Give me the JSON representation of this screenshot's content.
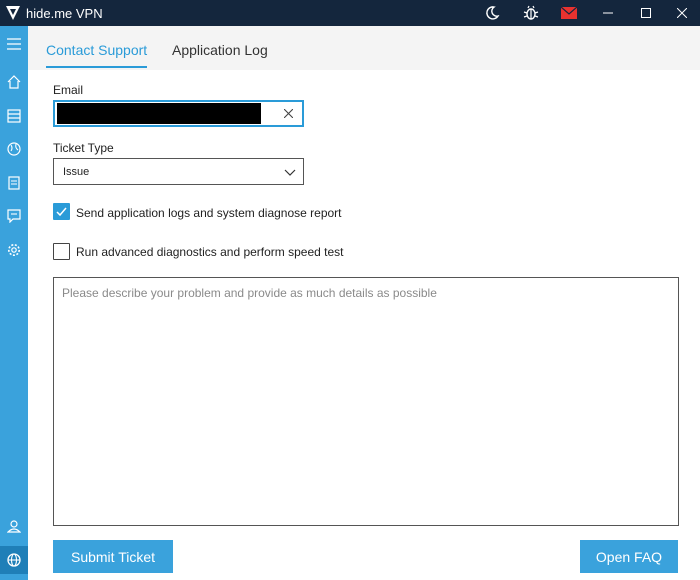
{
  "window": {
    "title": "hide.me VPN"
  },
  "titlebar": {
    "icons": [
      "moon-icon",
      "bug-icon",
      "mail-icon",
      "minimize-icon",
      "maximize-icon",
      "close-icon"
    ],
    "mail_color": "#e8322f"
  },
  "sidebar": {
    "items": [
      "menu-icon",
      "home-icon",
      "server-list-icon",
      "globe-icon",
      "document-icon",
      "support-chat-icon",
      "gear-icon"
    ],
    "bottom": [
      "user-icon",
      "language-globe-icon"
    ]
  },
  "tabs": [
    {
      "label": "Contact Support",
      "active": true
    },
    {
      "label": "Application Log",
      "active": false
    }
  ],
  "form": {
    "email_label": "Email",
    "email_value": "",
    "ticket_type_label": "Ticket Type",
    "ticket_type_value": "Issue",
    "send_logs_label": "Send application logs and system diagnose report",
    "send_logs_checked": true,
    "diagnostics_label": "Run advanced diagnostics and perform speed test",
    "diagnostics_checked": false,
    "description_placeholder": "Please describe your problem and provide as much details as possible"
  },
  "buttons": {
    "submit": "Submit Ticket",
    "faq": "Open FAQ"
  },
  "colors": {
    "accent": "#2a9bd8",
    "sidebar": "#3aa2dc",
    "titlebar": "#14263d"
  }
}
